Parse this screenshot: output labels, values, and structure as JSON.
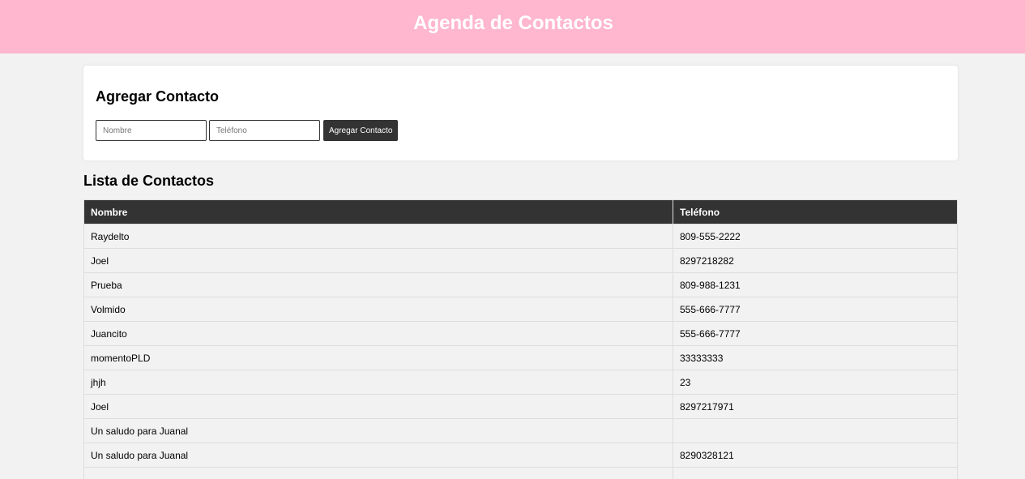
{
  "header": {
    "title": "Agenda de Contactos"
  },
  "add_form": {
    "title": "Agregar Contacto",
    "name_placeholder": "Nombre",
    "phone_placeholder": "Teléfono",
    "submit_label": "Agregar Contacto"
  },
  "contacts": {
    "title": "Lista de Contactos",
    "columns": [
      "Nombre",
      "Teléfono"
    ],
    "rows": [
      {
        "name": "Raydelto",
        "phone": "809-555-2222"
      },
      {
        "name": "Joel",
        "phone": "8297218282"
      },
      {
        "name": "Prueba",
        "phone": "809-988-1231"
      },
      {
        "name": "Volmido",
        "phone": "555-666-7777"
      },
      {
        "name": "Juancito",
        "phone": "555-666-7777"
      },
      {
        "name": "momentoPLD",
        "phone": "33333333"
      },
      {
        "name": "jhjh",
        "phone": "23"
      },
      {
        "name": "Joel",
        "phone": "8297217971"
      },
      {
        "name": "Un saludo para Juanal",
        "phone": ""
      },
      {
        "name": "Un saludo para Juanal",
        "phone": "8290328121"
      },
      {
        "name": "",
        "phone": ""
      }
    ]
  },
  "colors": {
    "header_bg": "#ffb6cf",
    "table_header_bg": "#333333",
    "button_bg": "#333333",
    "page_bg": "#f2f2f2"
  }
}
